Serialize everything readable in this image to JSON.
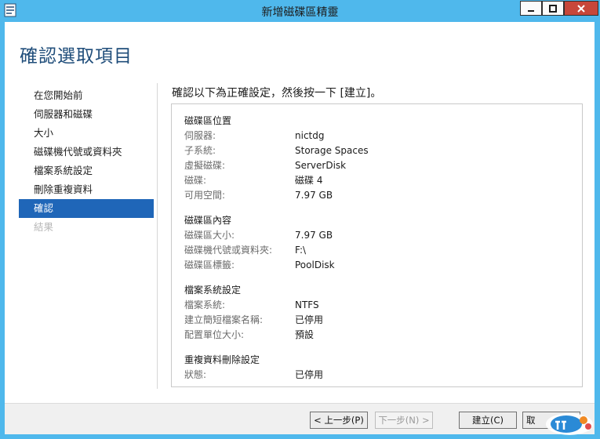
{
  "window": {
    "title": "新增磁碟區精靈"
  },
  "page": {
    "title": "確認選取項目",
    "instruction": "確認以下為正確設定，然後按一下 [建立]。"
  },
  "nav": {
    "items": [
      {
        "label": "在您開始前",
        "state": "normal"
      },
      {
        "label": "伺服器和磁碟",
        "state": "normal"
      },
      {
        "label": "大小",
        "state": "normal"
      },
      {
        "label": "磁碟機代號或資料夾",
        "state": "normal"
      },
      {
        "label": "檔案系統設定",
        "state": "normal"
      },
      {
        "label": "刪除重複資料",
        "state": "normal"
      },
      {
        "label": "確認",
        "state": "active"
      },
      {
        "label": "結果",
        "state": "disabled"
      }
    ]
  },
  "summary": {
    "sections": [
      {
        "title": "磁碟區位置",
        "rows": [
          {
            "label": "伺服器:",
            "value": "nictdg"
          },
          {
            "label": "子系統:",
            "value": "Storage Spaces"
          },
          {
            "label": "虛擬磁碟:",
            "value": "ServerDisk"
          },
          {
            "label": "磁碟:",
            "value": "磁碟 4"
          },
          {
            "label": "可用空間:",
            "value": "7.97 GB"
          }
        ]
      },
      {
        "title": "磁碟區內容",
        "rows": [
          {
            "label": "磁碟區大小:",
            "value": "7.97 GB"
          },
          {
            "label": "磁碟機代號或資料夾:",
            "value": "F:\\"
          },
          {
            "label": "磁碟區標籤:",
            "value": "PoolDisk"
          }
        ]
      },
      {
        "title": "檔案系統設定",
        "rows": [
          {
            "label": "檔案系統:",
            "value": "NTFS"
          },
          {
            "label": "建立簡短檔案名稱:",
            "value": "已停用"
          },
          {
            "label": "配置單位大小:",
            "value": "預設"
          }
        ]
      },
      {
        "title": "重複資料刪除設定",
        "rows": [
          {
            "label": "狀態:",
            "value": "已停用"
          }
        ]
      }
    ]
  },
  "footer": {
    "prev_label": "< 上一步(P)",
    "next_label": "下一步(N) >",
    "create_label": "建立(C)",
    "cancel_label": "取"
  },
  "colors": {
    "titlebar": "#4fb8ec",
    "accent": "#1f66b8",
    "heading": "#1f4d7a",
    "close": "#c7473a"
  },
  "icons": {
    "app": "wizard-window-icon",
    "minimize": "minimize-icon",
    "maximize": "maximize-icon",
    "close": "close-icon",
    "watermark": "ithome-logo"
  }
}
